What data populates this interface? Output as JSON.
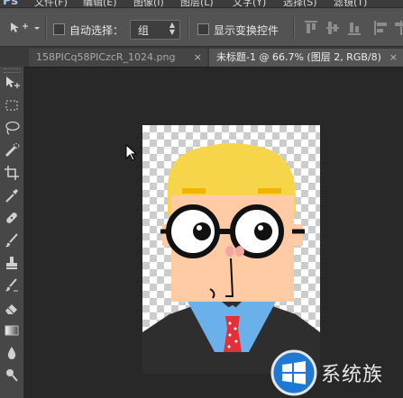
{
  "menubar": {
    "logo": "Ps",
    "items": [
      "文件(F)",
      "编辑(E)",
      "图像(I)",
      "图层(L)",
      "文字(Y)",
      "选择(S)",
      "滤镜(T)"
    ]
  },
  "options": {
    "auto_select_label": "自动选择：",
    "auto_select_value": "组",
    "show_transform_label": "显示变换控件"
  },
  "tabs": [
    {
      "label": "158PICq58PICzcR_1024.png",
      "close": "×"
    },
    {
      "label": "未标题-1 @ 66.7% (图层 2, RGB/8)",
      "close": "×"
    }
  ],
  "tools": [
    "move-tool",
    "marquee-tool",
    "lasso-tool",
    "quick-select-tool",
    "crop-tool",
    "eyedropper-tool",
    "healing-brush-tool",
    "brush-tool",
    "clone-stamp-tool",
    "history-brush-tool",
    "eraser-tool",
    "gradient-tool",
    "blur-tool"
  ],
  "watermark": {
    "text": "系统族"
  },
  "colors": {
    "hair": "#f7d54a",
    "skin": "#ffcba4",
    "shirt": "#6ab0ea",
    "suit": "#2e2e2e",
    "tie": "#e0303a"
  }
}
